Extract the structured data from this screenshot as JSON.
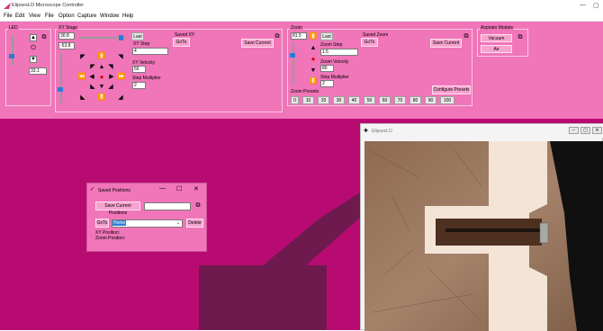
{
  "app": {
    "title": "ElipsesLO Microscope Controller",
    "min": "—",
    "max": "▢"
  },
  "menu": [
    "File",
    "Edit",
    "View",
    "File",
    "Option",
    "Capture",
    "Window",
    "Help"
  ],
  "led": {
    "label": "LED",
    "value": "33.1"
  },
  "xy": {
    "label": "XY Stage",
    "x": "30.8",
    "y": "-53.8",
    "last": "Last",
    "saved_label": "Saved XY",
    "goto": "GoTo",
    "save_current": "Save Current",
    "step_label": "XY Step",
    "step": "4",
    "velocity_label": "XY Velocity",
    "velocity": "55",
    "multiplier_label": "Step Multiplier",
    "multiplier": "2"
  },
  "zoom": {
    "label": "Zoom",
    "value": "81.5",
    "last": "Last",
    "saved_label": "Saved Zoom",
    "goto": "GoTo",
    "save_current": "Save Current",
    "step_label": "Zoom Step",
    "step": "1.5",
    "velocity_label": "Zoom Velocity",
    "velocity": "80",
    "multiplier_label": "Step Multiplier",
    "multiplier": "2",
    "presets_label": "Zoom Presets",
    "configure": "Configure Presets",
    "presets": [
      "0",
      "10",
      "20",
      "30",
      "40",
      "50",
      "60",
      "70",
      "80",
      "90",
      "100"
    ]
  },
  "aspirator": {
    "label": "Aspirato Module",
    "vacuum": "Vacuum",
    "air": "Air"
  },
  "camera": {
    "title": "ElipsesLO"
  },
  "saved_positions": {
    "title": "Saved Positions",
    "save_current": "Save Current Positions",
    "name_value": "",
    "goto": "GoTo",
    "selected": "Home",
    "delete": "Delete",
    "xy_position": "XY Position:",
    "zoom_position": "Zoom Position:",
    "min": "—",
    "max": "☐",
    "close": "✕"
  },
  "colors": {
    "panel": "#f075b9",
    "workspace": "#b80b72",
    "dark_shape": "#6e1a4e",
    "accent": "#2e7bd6"
  }
}
